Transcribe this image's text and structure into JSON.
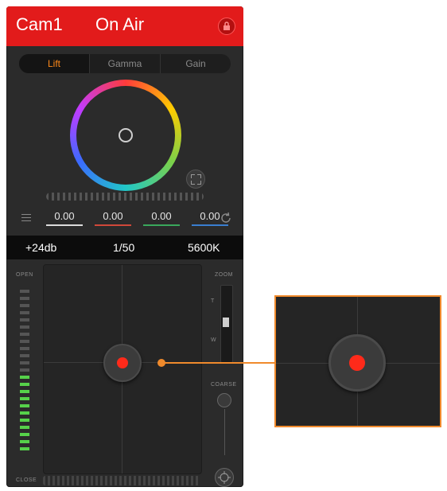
{
  "header": {
    "camera_name": "Cam1",
    "status": "On Air"
  },
  "tabs": [
    {
      "label": "Lift",
      "active": true
    },
    {
      "label": "Gamma",
      "active": false
    },
    {
      "label": "Gain",
      "active": false
    }
  ],
  "color_values": {
    "luma": "0.00",
    "red": "0.00",
    "green": "0.00",
    "blue": "0.00"
  },
  "info_bar": {
    "gain": "+24db",
    "shutter": "1/50",
    "white_balance": "5600K"
  },
  "iris": {
    "open_label": "OPEN",
    "close_label": "CLOSE"
  },
  "zoom": {
    "label": "ZOOM",
    "tele": "T",
    "wide": "W"
  },
  "coarse": {
    "label": "COARSE"
  },
  "colors": {
    "on_air_red": "#e21b1b",
    "accent_orange": "#f08a2c",
    "knob_red": "#ff2a1a"
  },
  "icons": [
    "lock-icon",
    "color-wheel-reset-icon",
    "menu-icon",
    "reset-icon",
    "focus-icon"
  ]
}
